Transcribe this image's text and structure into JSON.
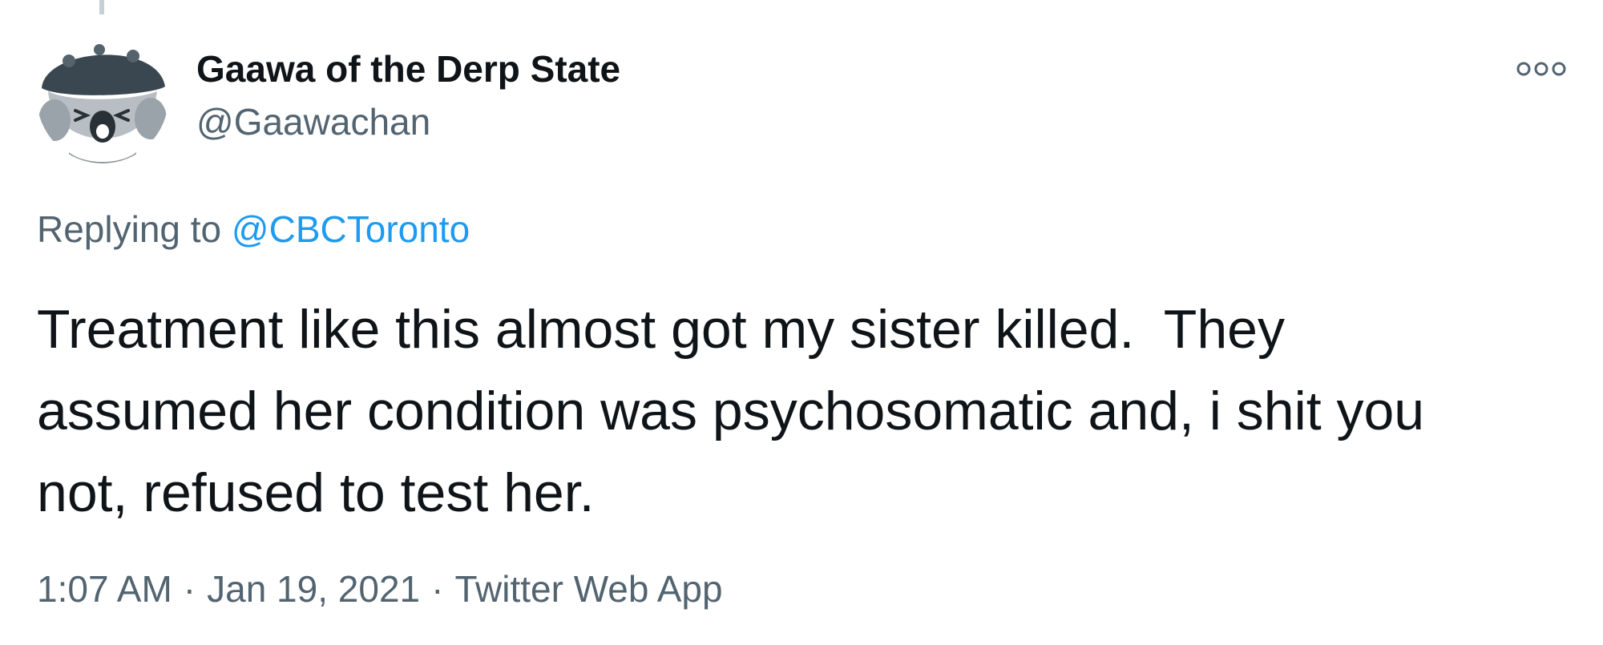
{
  "tweet": {
    "author": {
      "display_name": "Gaawa of the Derp State",
      "handle": "@Gaawachan",
      "avatar_icon": "koala-avatar-icon"
    },
    "more_icon": "more-options-icon",
    "reply": {
      "prefix": "Replying to",
      "mention": "@CBCToronto"
    },
    "text": "Treatment like this almost got my sister killed.  They\nassumed her condition was psychosomatic and, i shit you\nnot, refused to test her.",
    "meta": {
      "time": "1:07 AM",
      "separator": "·",
      "date": "Jan 19, 2021",
      "source": "Twitter Web App"
    },
    "colors": {
      "text": "#0f1419",
      "secondary": "#536471",
      "link": "#1d9bf0"
    }
  }
}
